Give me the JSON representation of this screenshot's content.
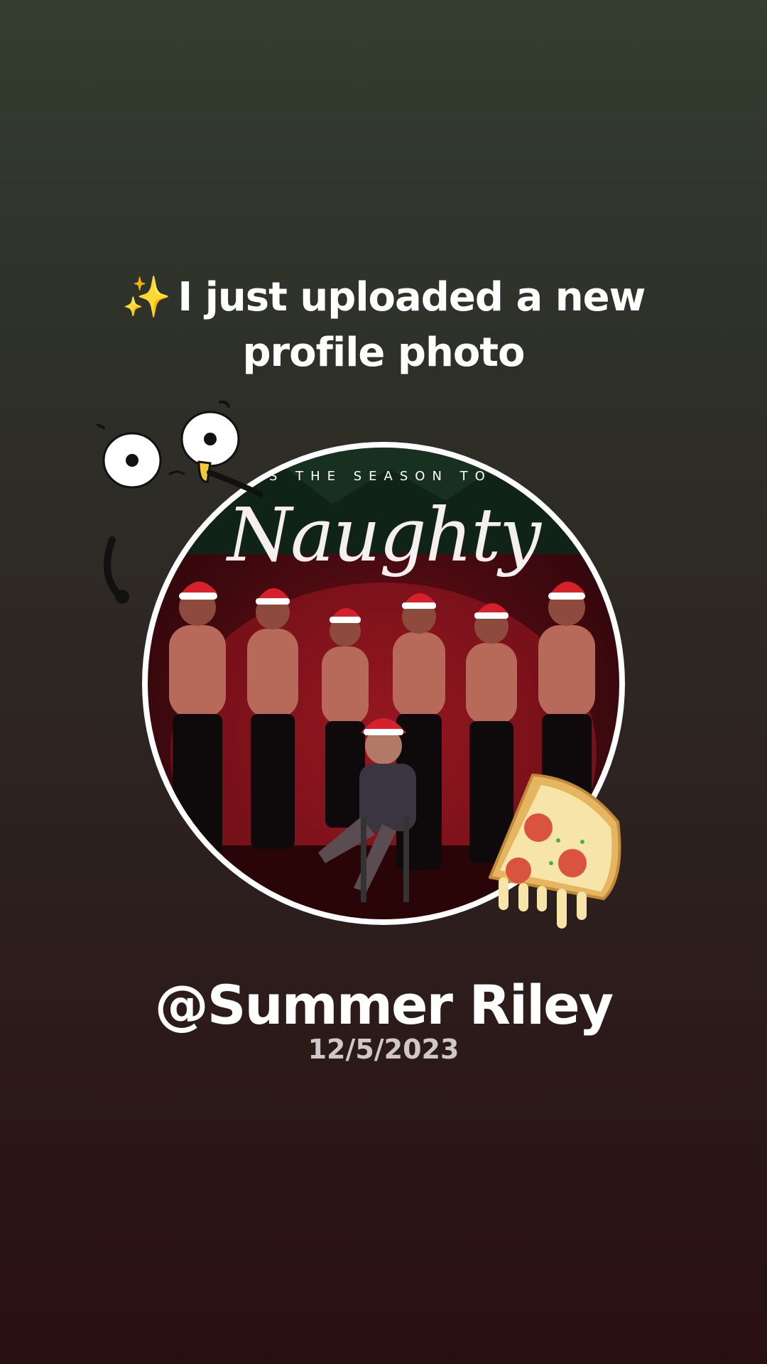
{
  "headline": {
    "sparkle_icon": "✨",
    "text": "I just uploaded a new profile photo"
  },
  "profile_photo": {
    "overlay_line": "'TIS THE SEASON TO BE",
    "overlay_title": "Naughty"
  },
  "user": {
    "handle": "@Summer Riley",
    "date": "12/5/2023"
  },
  "stickers": {
    "eyes": "googly-eyes-sticker",
    "pizza": "pizza-slice-sticker"
  },
  "colors": {
    "background_top": "#343d30",
    "background_bottom": "#2a0f11",
    "ring": "#ffffff",
    "text": "#ffffff",
    "date": "#cfc8c8"
  }
}
